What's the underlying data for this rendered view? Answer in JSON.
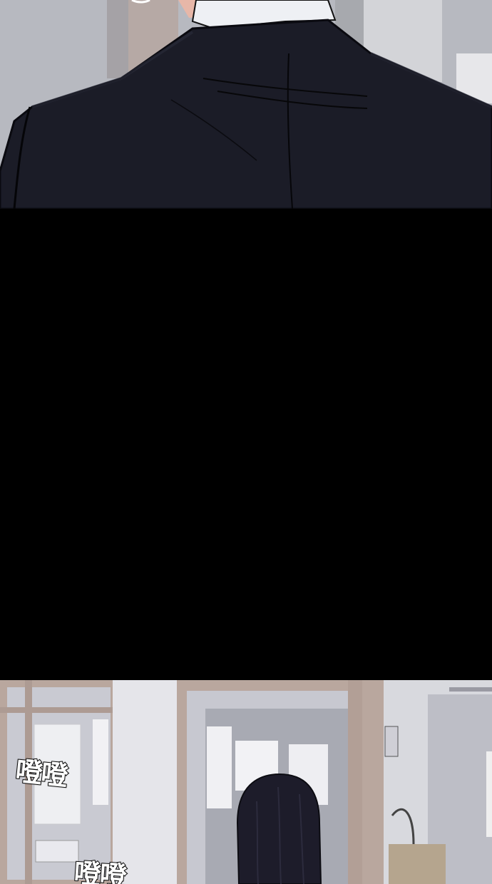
{
  "panels": {
    "top": {
      "depicts": "suit-back"
    },
    "middle": {
      "depicts": "black-gutter"
    },
    "bottom": {
      "depicts": "office-hallway-girl"
    }
  },
  "sound_effects": [
    "噔噔",
    "噔噔"
  ],
  "colors": {
    "suit": "#1b1c27",
    "gutter": "#000000",
    "hair": "#1d1c2a",
    "window_frame": "#b9a79e",
    "wall": "#d3d4da"
  }
}
